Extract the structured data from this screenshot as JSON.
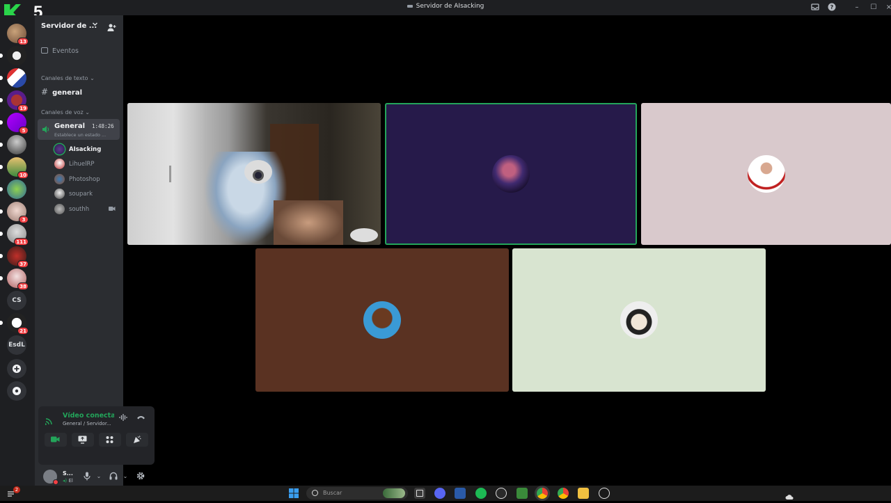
{
  "window": {
    "title": "Servidor de AIsacking"
  },
  "overlay": {
    "badge_number": "5"
  },
  "rail": {
    "badges": [
      "13",
      "19",
      "5",
      "10",
      "3",
      "111",
      "37",
      "38",
      "21"
    ],
    "text_guilds": [
      "CS",
      "EsdL"
    ]
  },
  "sidebar": {
    "server_name": "Servidor de ...",
    "events_label": "Eventos",
    "text_category": "Canales de texto",
    "text_channel": "general",
    "voice_category": "Canales de voz",
    "voice_channel": {
      "name": "General",
      "timer": "1:48:26",
      "status": "Establece un estado ..."
    },
    "members": [
      {
        "name": "AIsacking",
        "speaking": true
      },
      {
        "name": "LihuelRP"
      },
      {
        "name": "Photoshop"
      },
      {
        "name": "soupark"
      },
      {
        "name": "southh"
      }
    ]
  },
  "voice_panel": {
    "title": "Vídeo conectado",
    "subtitle": "General / Servidor..."
  },
  "user": {
    "name": "S...",
    "status": "El"
  },
  "taskbar": {
    "search_placeholder": "Buscar",
    "notification_count": "2"
  },
  "colors": {
    "accent_green": "#23a55a",
    "danger_red": "#f23f43",
    "tile_purple": "#261a4a",
    "tile_pink": "#d9c9cc",
    "tile_brown": "#5a3222",
    "tile_mint": "#d8e4d0"
  }
}
